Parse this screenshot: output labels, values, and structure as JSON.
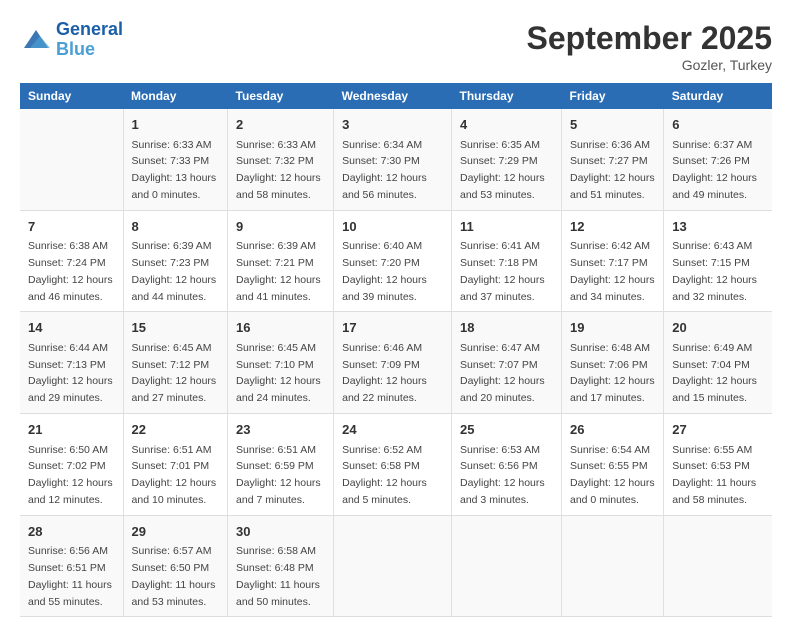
{
  "header": {
    "logo_line1": "General",
    "logo_line2": "Blue",
    "month_title": "September 2025",
    "location": "Gozler, Turkey"
  },
  "columns": [
    "Sunday",
    "Monday",
    "Tuesday",
    "Wednesday",
    "Thursday",
    "Friday",
    "Saturday"
  ],
  "weeks": [
    [
      {
        "day": "",
        "sunrise": "",
        "sunset": "",
        "daylight": ""
      },
      {
        "day": "1",
        "sunrise": "Sunrise: 6:33 AM",
        "sunset": "Sunset: 7:33 PM",
        "daylight": "Daylight: 13 hours and 0 minutes."
      },
      {
        "day": "2",
        "sunrise": "Sunrise: 6:33 AM",
        "sunset": "Sunset: 7:32 PM",
        "daylight": "Daylight: 12 hours and 58 minutes."
      },
      {
        "day": "3",
        "sunrise": "Sunrise: 6:34 AM",
        "sunset": "Sunset: 7:30 PM",
        "daylight": "Daylight: 12 hours and 56 minutes."
      },
      {
        "day": "4",
        "sunrise": "Sunrise: 6:35 AM",
        "sunset": "Sunset: 7:29 PM",
        "daylight": "Daylight: 12 hours and 53 minutes."
      },
      {
        "day": "5",
        "sunrise": "Sunrise: 6:36 AM",
        "sunset": "Sunset: 7:27 PM",
        "daylight": "Daylight: 12 hours and 51 minutes."
      },
      {
        "day": "6",
        "sunrise": "Sunrise: 6:37 AM",
        "sunset": "Sunset: 7:26 PM",
        "daylight": "Daylight: 12 hours and 49 minutes."
      }
    ],
    [
      {
        "day": "7",
        "sunrise": "Sunrise: 6:38 AM",
        "sunset": "Sunset: 7:24 PM",
        "daylight": "Daylight: 12 hours and 46 minutes."
      },
      {
        "day": "8",
        "sunrise": "Sunrise: 6:39 AM",
        "sunset": "Sunset: 7:23 PM",
        "daylight": "Daylight: 12 hours and 44 minutes."
      },
      {
        "day": "9",
        "sunrise": "Sunrise: 6:39 AM",
        "sunset": "Sunset: 7:21 PM",
        "daylight": "Daylight: 12 hours and 41 minutes."
      },
      {
        "day": "10",
        "sunrise": "Sunrise: 6:40 AM",
        "sunset": "Sunset: 7:20 PM",
        "daylight": "Daylight: 12 hours and 39 minutes."
      },
      {
        "day": "11",
        "sunrise": "Sunrise: 6:41 AM",
        "sunset": "Sunset: 7:18 PM",
        "daylight": "Daylight: 12 hours and 37 minutes."
      },
      {
        "day": "12",
        "sunrise": "Sunrise: 6:42 AM",
        "sunset": "Sunset: 7:17 PM",
        "daylight": "Daylight: 12 hours and 34 minutes."
      },
      {
        "day": "13",
        "sunrise": "Sunrise: 6:43 AM",
        "sunset": "Sunset: 7:15 PM",
        "daylight": "Daylight: 12 hours and 32 minutes."
      }
    ],
    [
      {
        "day": "14",
        "sunrise": "Sunrise: 6:44 AM",
        "sunset": "Sunset: 7:13 PM",
        "daylight": "Daylight: 12 hours and 29 minutes."
      },
      {
        "day": "15",
        "sunrise": "Sunrise: 6:45 AM",
        "sunset": "Sunset: 7:12 PM",
        "daylight": "Daylight: 12 hours and 27 minutes."
      },
      {
        "day": "16",
        "sunrise": "Sunrise: 6:45 AM",
        "sunset": "Sunset: 7:10 PM",
        "daylight": "Daylight: 12 hours and 24 minutes."
      },
      {
        "day": "17",
        "sunrise": "Sunrise: 6:46 AM",
        "sunset": "Sunset: 7:09 PM",
        "daylight": "Daylight: 12 hours and 22 minutes."
      },
      {
        "day": "18",
        "sunrise": "Sunrise: 6:47 AM",
        "sunset": "Sunset: 7:07 PM",
        "daylight": "Daylight: 12 hours and 20 minutes."
      },
      {
        "day": "19",
        "sunrise": "Sunrise: 6:48 AM",
        "sunset": "Sunset: 7:06 PM",
        "daylight": "Daylight: 12 hours and 17 minutes."
      },
      {
        "day": "20",
        "sunrise": "Sunrise: 6:49 AM",
        "sunset": "Sunset: 7:04 PM",
        "daylight": "Daylight: 12 hours and 15 minutes."
      }
    ],
    [
      {
        "day": "21",
        "sunrise": "Sunrise: 6:50 AM",
        "sunset": "Sunset: 7:02 PM",
        "daylight": "Daylight: 12 hours and 12 minutes."
      },
      {
        "day": "22",
        "sunrise": "Sunrise: 6:51 AM",
        "sunset": "Sunset: 7:01 PM",
        "daylight": "Daylight: 12 hours and 10 minutes."
      },
      {
        "day": "23",
        "sunrise": "Sunrise: 6:51 AM",
        "sunset": "Sunset: 6:59 PM",
        "daylight": "Daylight: 12 hours and 7 minutes."
      },
      {
        "day": "24",
        "sunrise": "Sunrise: 6:52 AM",
        "sunset": "Sunset: 6:58 PM",
        "daylight": "Daylight: 12 hours and 5 minutes."
      },
      {
        "day": "25",
        "sunrise": "Sunrise: 6:53 AM",
        "sunset": "Sunset: 6:56 PM",
        "daylight": "Daylight: 12 hours and 3 minutes."
      },
      {
        "day": "26",
        "sunrise": "Sunrise: 6:54 AM",
        "sunset": "Sunset: 6:55 PM",
        "daylight": "Daylight: 12 hours and 0 minutes."
      },
      {
        "day": "27",
        "sunrise": "Sunrise: 6:55 AM",
        "sunset": "Sunset: 6:53 PM",
        "daylight": "Daylight: 11 hours and 58 minutes."
      }
    ],
    [
      {
        "day": "28",
        "sunrise": "Sunrise: 6:56 AM",
        "sunset": "Sunset: 6:51 PM",
        "daylight": "Daylight: 11 hours and 55 minutes."
      },
      {
        "day": "29",
        "sunrise": "Sunrise: 6:57 AM",
        "sunset": "Sunset: 6:50 PM",
        "daylight": "Daylight: 11 hours and 53 minutes."
      },
      {
        "day": "30",
        "sunrise": "Sunrise: 6:58 AM",
        "sunset": "Sunset: 6:48 PM",
        "daylight": "Daylight: 11 hours and 50 minutes."
      },
      {
        "day": "",
        "sunrise": "",
        "sunset": "",
        "daylight": ""
      },
      {
        "day": "",
        "sunrise": "",
        "sunset": "",
        "daylight": ""
      },
      {
        "day": "",
        "sunrise": "",
        "sunset": "",
        "daylight": ""
      },
      {
        "day": "",
        "sunrise": "",
        "sunset": "",
        "daylight": ""
      }
    ]
  ]
}
